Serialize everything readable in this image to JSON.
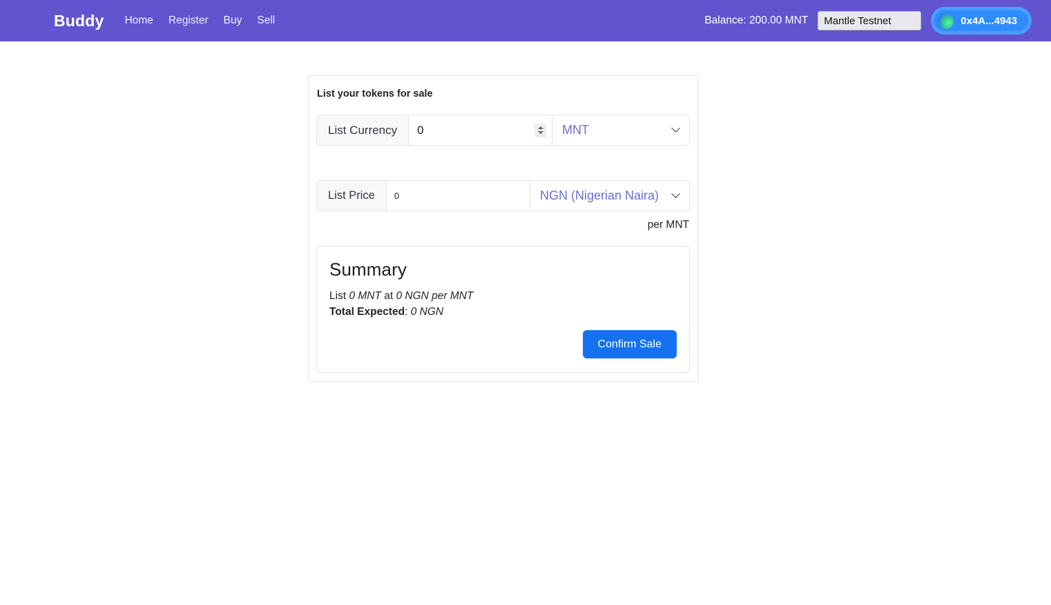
{
  "navbar": {
    "brand": "Buddy",
    "links": [
      {
        "label": "Home"
      },
      {
        "label": "Register"
      },
      {
        "label": "Buy"
      },
      {
        "label": "Sell"
      }
    ],
    "balance": "Balance: 200.00 MNT",
    "network": {
      "selected": "Mantle Testnet",
      "options": [
        "Mantle Testnet"
      ]
    },
    "wallet": {
      "address": "0x4A...4943",
      "avatar_icon": "wallet-avatar-gradient"
    },
    "background_color": "#6254cf"
  },
  "card": {
    "title": "List your tokens for sale",
    "list_currency": {
      "label": "List Currency",
      "amount_value": "0",
      "amount_placeholder": "0",
      "spinner_icon": "number-spinner-icon",
      "token": {
        "selected": "MNT",
        "options": [
          "MNT"
        ],
        "chevron_icon": "chevron-down-icon"
      }
    },
    "list_price": {
      "label": "List Price",
      "price_value": "0",
      "price_placeholder": "0",
      "fiat": {
        "selected": "NGN (Nigerian Naira)",
        "options": [
          "NGN (Nigerian Naira)"
        ],
        "chevron_icon": "chevron-down-icon"
      }
    },
    "per_unit": "per MNT",
    "summary": {
      "heading": "Summary",
      "list_prefix": "List ",
      "list_amount": "0 MNT",
      "list_mid": " at ",
      "list_rate": "0 NGN per MNT",
      "total_label": "Total Expected",
      "total_separator": ": ",
      "total_value": "0 NGN",
      "confirm_label": "Confirm Sale",
      "confirm_color": "#1472f0"
    }
  }
}
